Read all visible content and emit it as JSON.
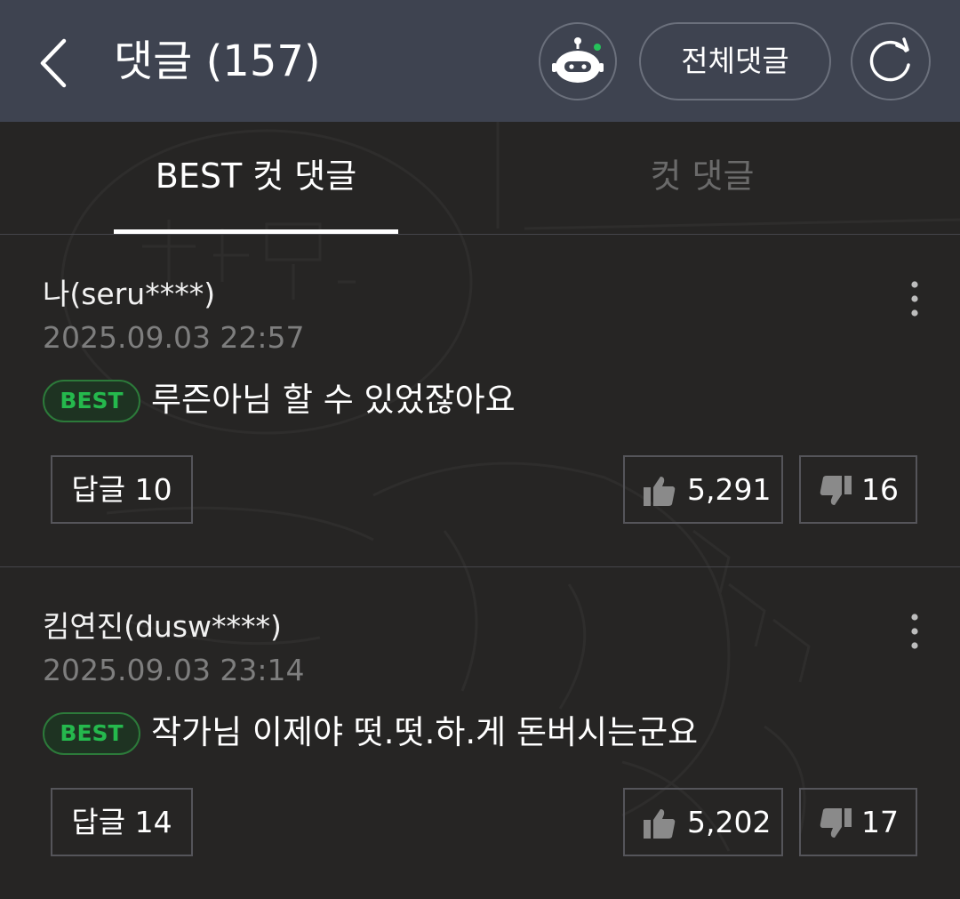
{
  "header": {
    "title": "댓글 (157)",
    "all_comments_label": "전체댓글",
    "icons": {
      "back": "chevron-left-icon",
      "bot": "robot-icon",
      "refresh": "refresh-icon"
    }
  },
  "tabs": [
    {
      "label": "BEST 컷 댓글",
      "active": true
    },
    {
      "label": "컷 댓글",
      "active": false
    }
  ],
  "comments": [
    {
      "author": "나(seru****)",
      "date": "2025.09.03 22:57",
      "badge": "BEST",
      "text": "루즌아님 할 수 있었잖아요",
      "reply_label": "답글 10",
      "likes": "5,291",
      "dislikes": "16"
    },
    {
      "author": "킴연진(dusw****)",
      "date": "2025.09.03 23:14",
      "badge": "BEST",
      "text": "작가님 이제야 떳.떳.하.게 돈버시는군요",
      "reply_label": "답글 14",
      "likes": "5,202",
      "dislikes": "17"
    }
  ],
  "colors": {
    "header_bg": "#3e4350",
    "body_bg": "#262524",
    "best_green": "#25b84d",
    "muted_text": "#7e7e7e"
  }
}
